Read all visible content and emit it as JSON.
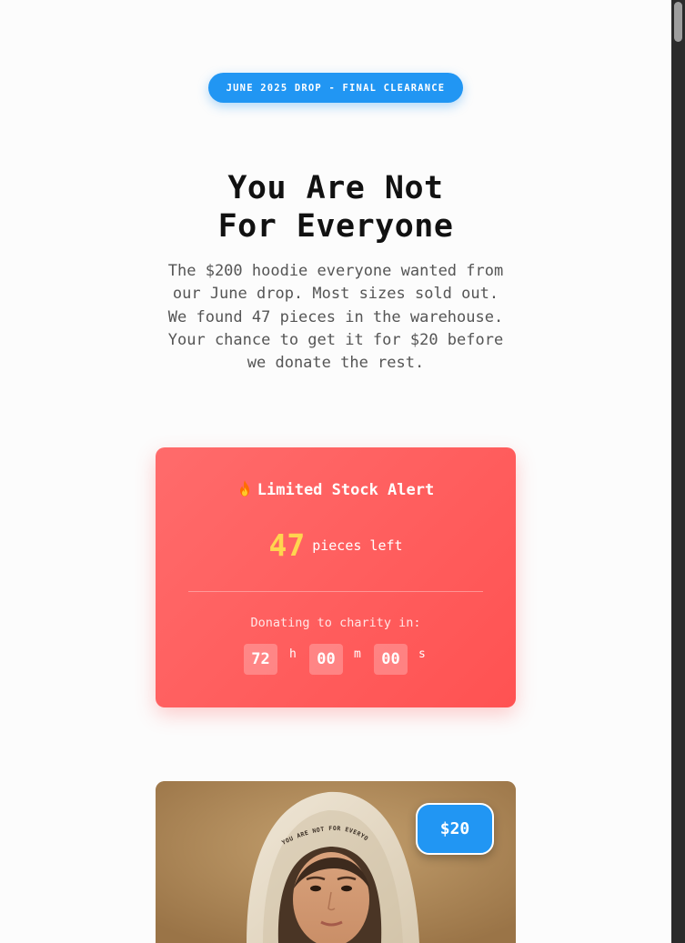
{
  "badge": {
    "label": "JUNE 2025 DROP - FINAL CLEARANCE"
  },
  "hero": {
    "headline_line1": "You Are Not",
    "headline_line2": "For Everyone",
    "description_lines": [
      "The $200 hoodie everyone wanted from",
      "our June drop. Most sizes sold out.",
      "We found 47 pieces in the warehouse.",
      "Your chance to get it for $20 before",
      "we donate the rest."
    ]
  },
  "alert": {
    "title": "Limited Stock Alert",
    "icon": "fire-icon",
    "stock_count": "47",
    "stock_label": "pieces left",
    "donate_label": "Donating to charity in:",
    "timer": {
      "hours": "72",
      "hours_unit": "h",
      "minutes": "00",
      "minutes_unit": "m",
      "seconds": "00",
      "seconds_unit": "s"
    }
  },
  "product": {
    "price": "$20",
    "hood_print": "YOU ARE NOT FOR EVERYONE"
  },
  "colors": {
    "accent_blue": "#2196f3",
    "alert_red": "#ff5a5a",
    "stock_yellow": "#ffd54f",
    "text_dark": "#111111",
    "text_muted": "#555555"
  }
}
